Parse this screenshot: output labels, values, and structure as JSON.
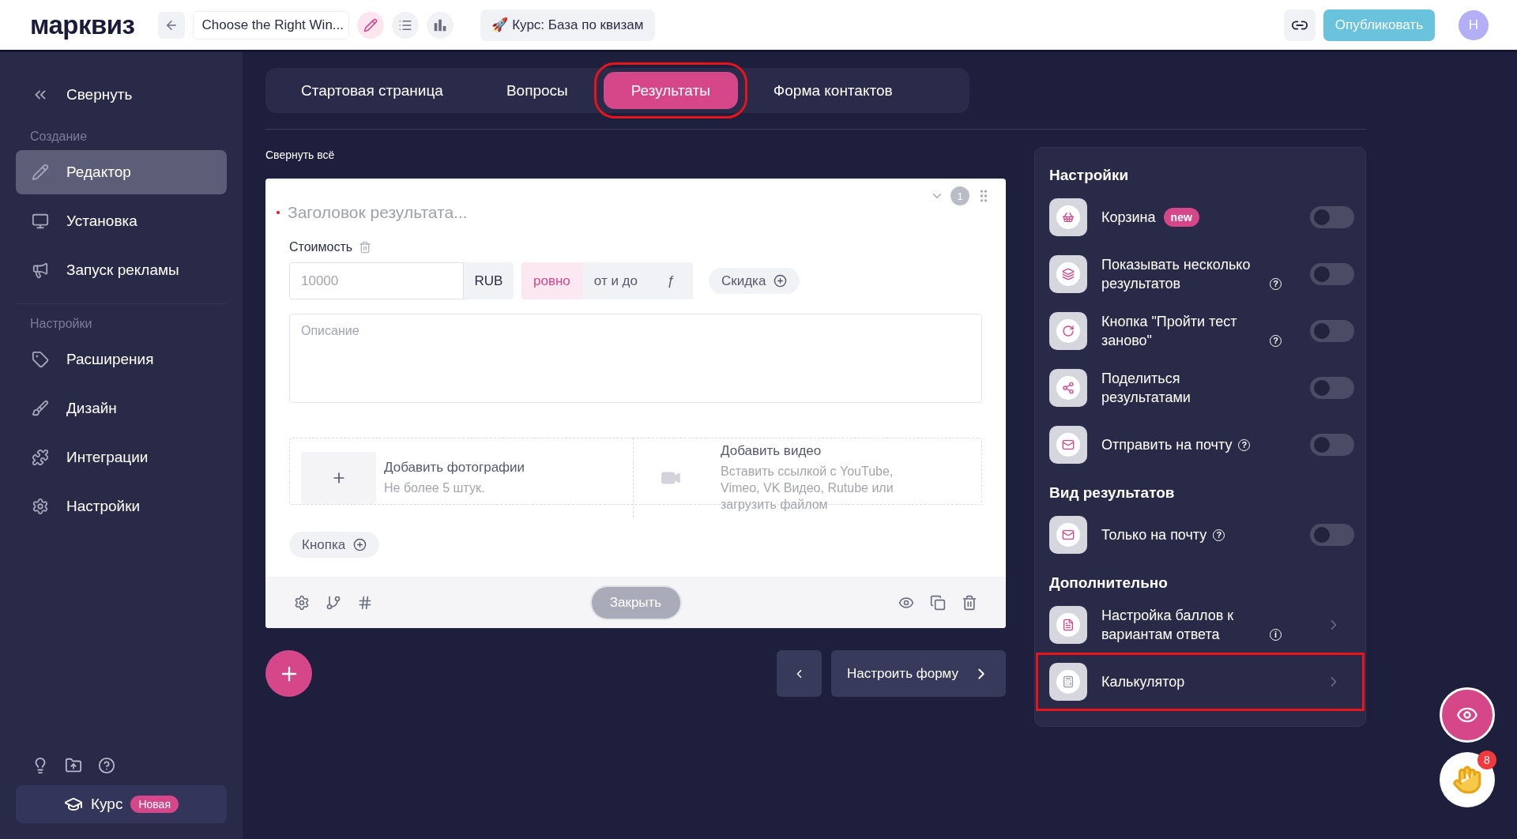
{
  "header": {
    "logo": "марквиз",
    "quiz_title": "Choose the Right Win...",
    "course_chip": "🚀 Курс: База по квизам",
    "publish": "Опубликовать",
    "avatar": "Н"
  },
  "sidebar": {
    "collapse": "Свернуть",
    "sections": [
      {
        "title": "Создание",
        "items": [
          {
            "label": "Редактор",
            "selected": true
          },
          {
            "label": "Установка",
            "selected": false
          },
          {
            "label": "Запуск рекламы",
            "selected": false
          }
        ]
      },
      {
        "title": "Настройки",
        "items": [
          {
            "label": "Расширения",
            "selected": false
          },
          {
            "label": "Дизайн",
            "selected": false
          },
          {
            "label": "Интеграции",
            "selected": false
          },
          {
            "label": "Настройки",
            "selected": false
          }
        ]
      }
    ],
    "course": {
      "label": "Курс",
      "badge": "Новая"
    }
  },
  "tabs": [
    {
      "label": "Стартовая страница",
      "selected": false,
      "highlighted": false
    },
    {
      "label": "Вопросы",
      "selected": false,
      "highlighted": false
    },
    {
      "label": "Результаты",
      "selected": true,
      "highlighted": true
    },
    {
      "label": "Форма контактов",
      "selected": false,
      "highlighted": false
    }
  ],
  "collapse_all": "Свернуть всё",
  "result_card": {
    "title_placeholder": "Заголовок результата...",
    "number": "1",
    "price_label": "Стоимость",
    "price_placeholder": "10000",
    "currency": "RUB",
    "price_modes": [
      {
        "label": "ровно",
        "selected": true
      },
      {
        "label": "от и до",
        "selected": false
      },
      {
        "label": "ƒ",
        "selected": false
      }
    ],
    "discount": "Скидка",
    "description_placeholder": "Описание",
    "photo": {
      "title": "Добавить фотографии",
      "hint": "Не более 5 штук."
    },
    "video": {
      "title": "Добавить видео",
      "hint": "Вставить ссылкой с YouTube, Vimeo, VK Видео, Rutube или загрузить файлом"
    },
    "button": "Кнопка",
    "close": "Закрыть"
  },
  "next_button": "Настроить форму",
  "settings_panel": {
    "sections": [
      {
        "title": "Настройки",
        "items": [
          {
            "kind": "toggle",
            "label": "Корзина",
            "badge": "new",
            "on": false
          },
          {
            "kind": "toggle",
            "label": "Показывать несколько результатов",
            "hint": "?",
            "on": false
          },
          {
            "kind": "toggle",
            "label": "Кнопка \"Пройти тест заново\"",
            "hint": "?",
            "on": false
          },
          {
            "kind": "toggle",
            "label": "Поделиться результатами",
            "on": false
          },
          {
            "kind": "toggle",
            "label": "Отправить на почту",
            "hint": "?",
            "on": false
          }
        ]
      },
      {
        "title": "Вид результатов",
        "items": [
          {
            "kind": "toggle",
            "label": "Только на почту",
            "hint": "?",
            "on": false
          }
        ]
      },
      {
        "title": "Дополнительно",
        "items": [
          {
            "kind": "link",
            "label": "Настройка баллов к вариантам ответа",
            "hint": "i",
            "highlighted": false
          },
          {
            "kind": "link",
            "label": "Калькулятор",
            "highlighted": true
          }
        ]
      }
    ]
  },
  "notifications": {
    "count": "8"
  }
}
